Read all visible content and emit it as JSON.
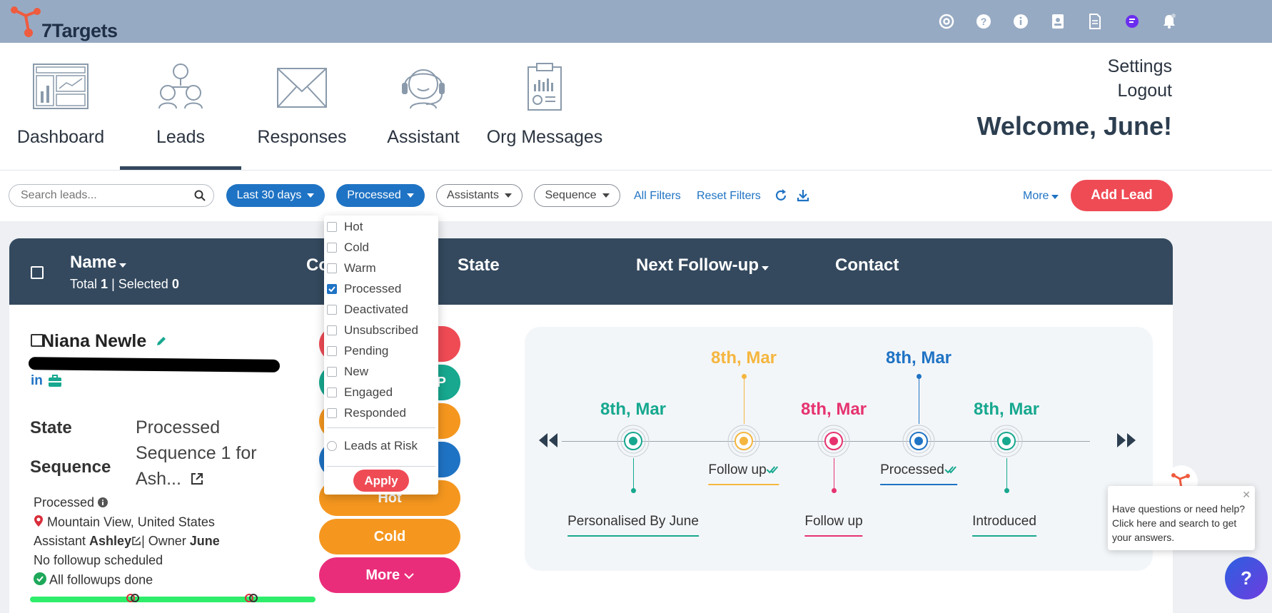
{
  "app": {
    "name": "7Targets"
  },
  "top_icons": [
    "at-icon",
    "question-icon",
    "info-icon",
    "contacts-icon",
    "document-icon",
    "user-avatar-icon",
    "bell-icon"
  ],
  "nav": {
    "items": [
      {
        "label": "Dashboard",
        "icon": "dashboard-icon"
      },
      {
        "label": "Leads",
        "icon": "leads-icon",
        "active": true
      },
      {
        "label": "Responses",
        "icon": "envelope-icon"
      },
      {
        "label": "Assistant",
        "icon": "headset-icon"
      },
      {
        "label": "Org Messages",
        "icon": "report-icon"
      }
    ],
    "settings": "Settings",
    "logout": "Logout",
    "welcome": "Welcome, June!"
  },
  "filters": {
    "search_placeholder": "Search leads...",
    "date_range": "Last 30 days",
    "state": "Processed",
    "assistants": "Assistants",
    "sequence": "Sequence",
    "all_filters": "All Filters",
    "reset_filters": "Reset Filters",
    "more": "More",
    "add_lead": "Add Lead"
  },
  "state_dropdown": {
    "options": [
      {
        "label": "Hot",
        "checked": false
      },
      {
        "label": "Cold",
        "checked": false
      },
      {
        "label": "Warm",
        "checked": false
      },
      {
        "label": "Processed",
        "checked": true
      },
      {
        "label": "Deactivated",
        "checked": false
      },
      {
        "label": "Unsubscribed",
        "checked": false
      },
      {
        "label": "Pending",
        "checked": false
      },
      {
        "label": "New",
        "checked": false
      },
      {
        "label": "Engaged",
        "checked": false
      },
      {
        "label": "Responded",
        "checked": false
      }
    ],
    "leads_at_risk": "Leads at Risk",
    "apply": "Apply"
  },
  "table": {
    "headers": {
      "name": "Name",
      "company": "Co",
      "state": "State",
      "next_followup": "Next Follow-up",
      "contact": "Contact"
    },
    "total_label": "Total",
    "total_count": "1",
    "selected_label": "| Selected",
    "selected_count": "0"
  },
  "lead": {
    "name": "Niana Newle",
    "linkedin": "in",
    "state_label": "State",
    "state_value": "Processed",
    "sequence_label": "Sequence",
    "sequence_value_line1": "Sequence 1 for",
    "sequence_value_line2": "Ash...",
    "status": "Processed",
    "location": "Mountain View, United States",
    "assistant_label": "Assistant",
    "assistant_name": "Ashley",
    "owner_label": "| Owner",
    "owner_name": "June",
    "no_followup": "No followup scheduled",
    "followups_done": "All followups done",
    "progress": 1.0
  },
  "action_buttons": {
    "hot": "Hot",
    "cold": "Cold",
    "more": "More",
    "partial_label": "P"
  },
  "timeline": {
    "events": [
      {
        "date": "8th, Mar",
        "label": "Personalised By June",
        "color": "#17a88f",
        "position": "below"
      },
      {
        "date": "8th, Mar",
        "label": "Follow up",
        "color": "#f5b63f",
        "position": "above",
        "checked": true
      },
      {
        "date": "8th, Mar",
        "label": "Follow up",
        "color": "#e6336f",
        "position": "below"
      },
      {
        "date": "8th, Mar",
        "label": "Processed",
        "color": "#1f73c4",
        "position": "above",
        "checked": true
      },
      {
        "date": "8th, Mar",
        "label": "Introduced",
        "color": "#17a88f",
        "position": "below"
      }
    ]
  },
  "help": {
    "text": "Have questions or need help? Click here and search to get your answers.",
    "button": "?"
  },
  "colors": {
    "topbar": "#97aac3",
    "header": "#34495e",
    "primary": "#1f73c4",
    "accent_red": "#ef4b55",
    "orange": "#f5971f",
    "pink": "#ea2d7b",
    "teal": "#17a88f"
  }
}
